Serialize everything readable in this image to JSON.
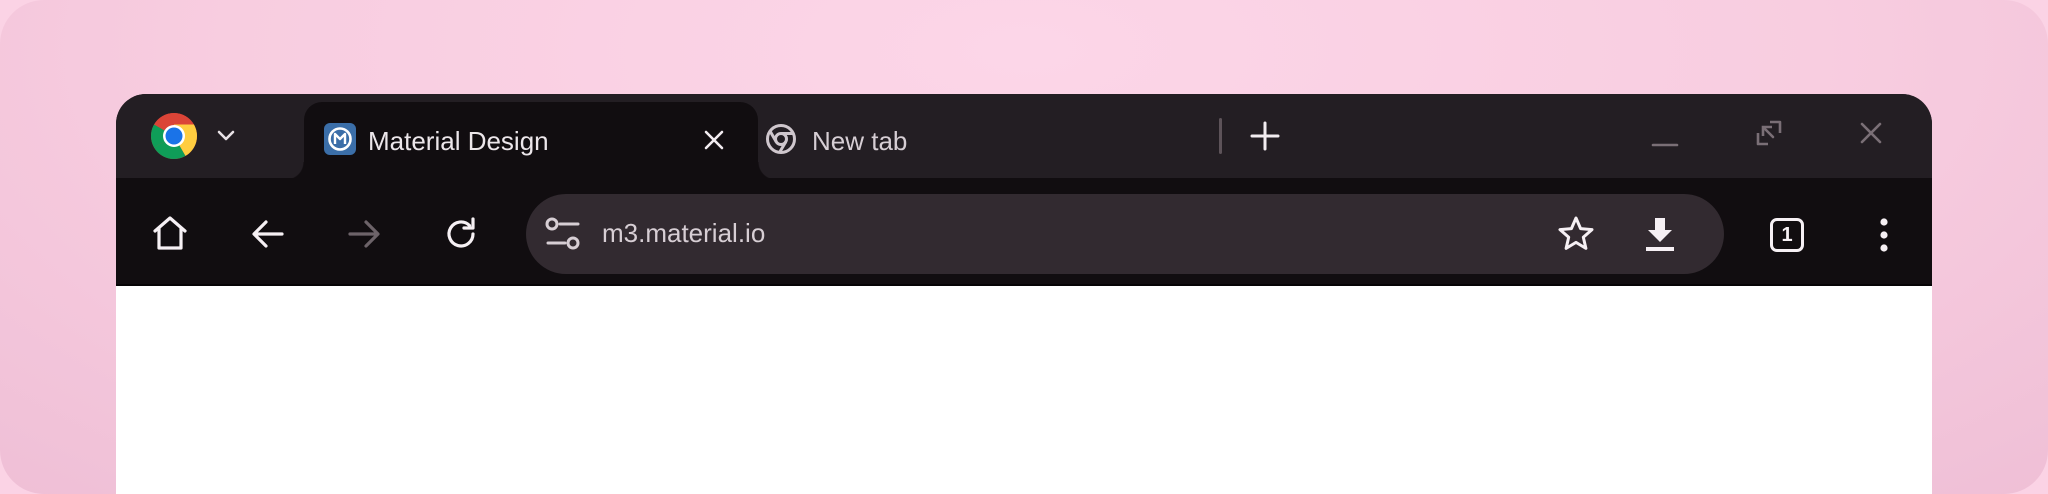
{
  "browser": {
    "tabs": [
      {
        "title": "Material Design",
        "active": true,
        "icon": "material-design-favicon"
      },
      {
        "title": "New tab",
        "active": false,
        "icon": "chrome-favicon"
      }
    ],
    "address_bar": {
      "url": "m3.material.io"
    },
    "tab_count": "1"
  },
  "colors": {
    "backdrop": "#fbd3e5",
    "tabstrip": "#231e23",
    "toolbar": "#110d10",
    "omnibox": "#322a30",
    "text": "#ece6ea"
  }
}
